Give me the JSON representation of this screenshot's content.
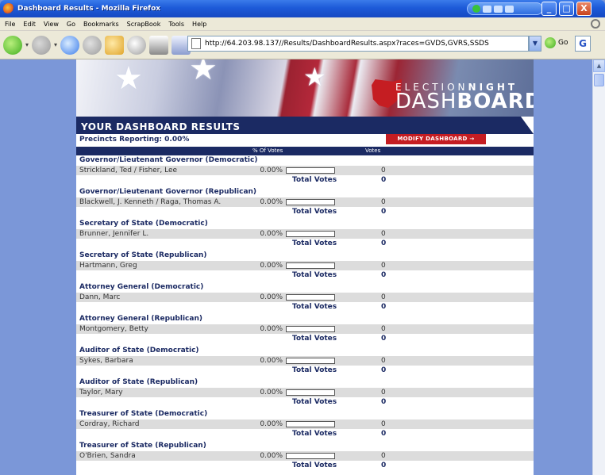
{
  "window": {
    "title": "Dashboard Results - Mozilla Firefox",
    "controls": {
      "min": "_",
      "max": "□",
      "close": "X"
    }
  },
  "menu": [
    "File",
    "Edit",
    "View",
    "Go",
    "Bookmarks",
    "ScrapBook",
    "Tools",
    "Help"
  ],
  "address": {
    "url": "http://64.203.98.137//Results/DashboardResults.aspx?races=GVDS,GVRS,SSDS",
    "go_label": "Go"
  },
  "banner": {
    "brand_top_a": "ELECTION",
    "brand_top_b": "NIGHT",
    "brand_bottom_a": "DASH",
    "brand_bottom_b": "BOARD"
  },
  "dashboard": {
    "heading": "YOUR DASHBOARD RESULTS",
    "precincts": "Precincts Reporting: 0.00%",
    "modify_label": "MODIFY DASHBOARD →",
    "col_pct": "% Of Votes",
    "col_votes": "Votes",
    "total_label": "Total Votes"
  },
  "races": [
    {
      "title": "Governor/Lieutenant Governor (Democratic)",
      "candidate": "Strickland, Ted / Fisher, Lee",
      "pct": "0.00%",
      "pct_value": 0,
      "votes": "0",
      "total": "0"
    },
    {
      "title": "Governor/Lieutenant Governor (Republican)",
      "candidate": "Blackwell, J. Kenneth / Raga, Thomas A.",
      "pct": "0.00%",
      "pct_value": 0,
      "votes": "0",
      "total": "0"
    },
    {
      "title": "Secretary of State (Democratic)",
      "candidate": "Brunner, Jennifer L.",
      "pct": "0.00%",
      "pct_value": 0,
      "votes": "0",
      "total": "0"
    },
    {
      "title": "Secretary of State (Republican)",
      "candidate": "Hartmann, Greg",
      "pct": "0.00%",
      "pct_value": 0,
      "votes": "0",
      "total": "0"
    },
    {
      "title": "Attorney General (Democratic)",
      "candidate": "Dann, Marc",
      "pct": "0.00%",
      "pct_value": 0,
      "votes": "0",
      "total": "0"
    },
    {
      "title": "Attorney General (Republican)",
      "candidate": "Montgomery, Betty",
      "pct": "0.00%",
      "pct_value": 0,
      "votes": "0",
      "total": "0"
    },
    {
      "title": "Auditor of State (Democratic)",
      "candidate": "Sykes, Barbara",
      "pct": "0.00%",
      "pct_value": 0,
      "votes": "0",
      "total": "0"
    },
    {
      "title": "Auditor of State (Republican)",
      "candidate": "Taylor, Mary",
      "pct": "0.00%",
      "pct_value": 0,
      "votes": "0",
      "total": "0"
    },
    {
      "title": "Treasurer of State (Democratic)",
      "candidate": "Cordray, Richard",
      "pct": "0.00%",
      "pct_value": 0,
      "votes": "0",
      "total": "0"
    },
    {
      "title": "Treasurer of State (Republican)",
      "candidate": "O'Brien, Sandra",
      "pct": "0.00%",
      "pct_value": 0,
      "votes": "0",
      "total": "0"
    }
  ]
}
